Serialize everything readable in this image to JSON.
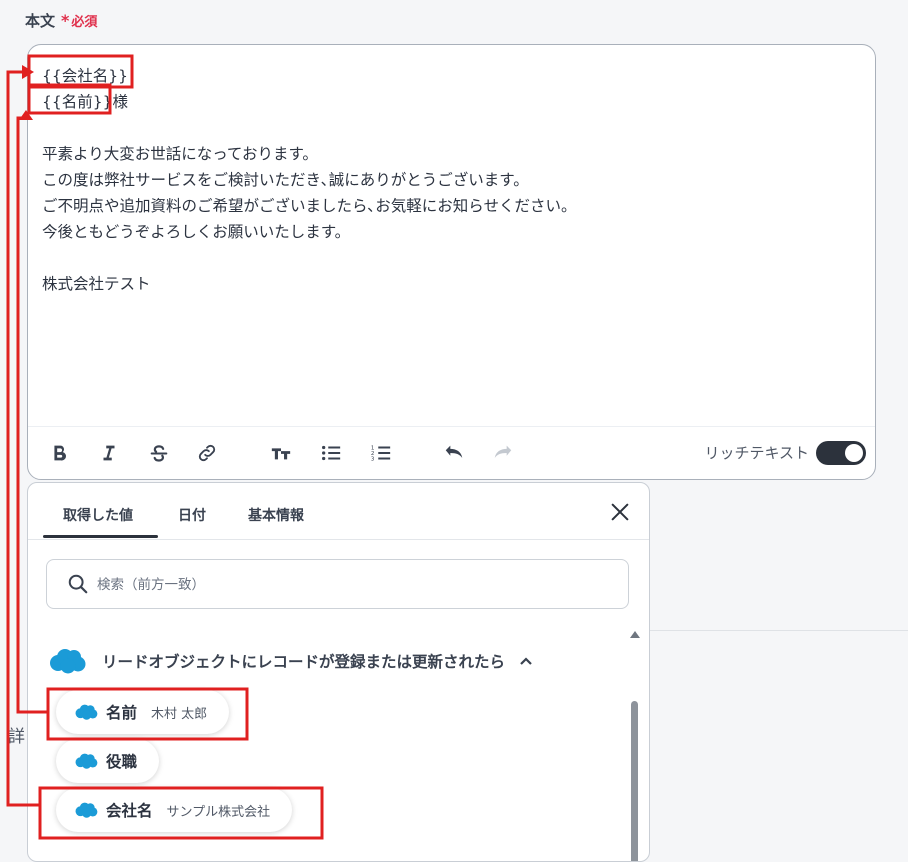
{
  "field": {
    "label": "本文",
    "required_star": "*",
    "required_text": "必須"
  },
  "editor": {
    "lines": [
      "{{会社名}}",
      "{{名前}}様",
      "",
      "平素より大変お世話になっております。",
      "この度は弊社サービスをご検討いただき､誠にありがとうございます。",
      "ご不明点や追加資料のご希望がございましたら､お気軽にお知らせください。",
      "今後ともどうぞよろしくお願いいたします。",
      "",
      "株式会社テスト"
    ],
    "rich_text_label": "リッチテキスト",
    "rich_text_enabled": true
  },
  "panel": {
    "tabs": [
      "取得した値",
      "日付",
      "基本情報"
    ],
    "active_tab": "取得した値",
    "search_placeholder": "検索（前方一致）",
    "group_title": "リードオブジェクトにレコードが登録または更新されたら",
    "items": [
      {
        "label": "名前",
        "value": "木村 太郎"
      },
      {
        "label": "役職",
        "value": ""
      },
      {
        "label": "会社名",
        "value": "サンプル株式会社"
      }
    ]
  },
  "partial_text": "詳",
  "colors": {
    "annotation_red": "#e02020",
    "required_red": "#e0304c",
    "salesforce_blue": "#1b9bd7",
    "toggle_dark": "#2c323c"
  }
}
